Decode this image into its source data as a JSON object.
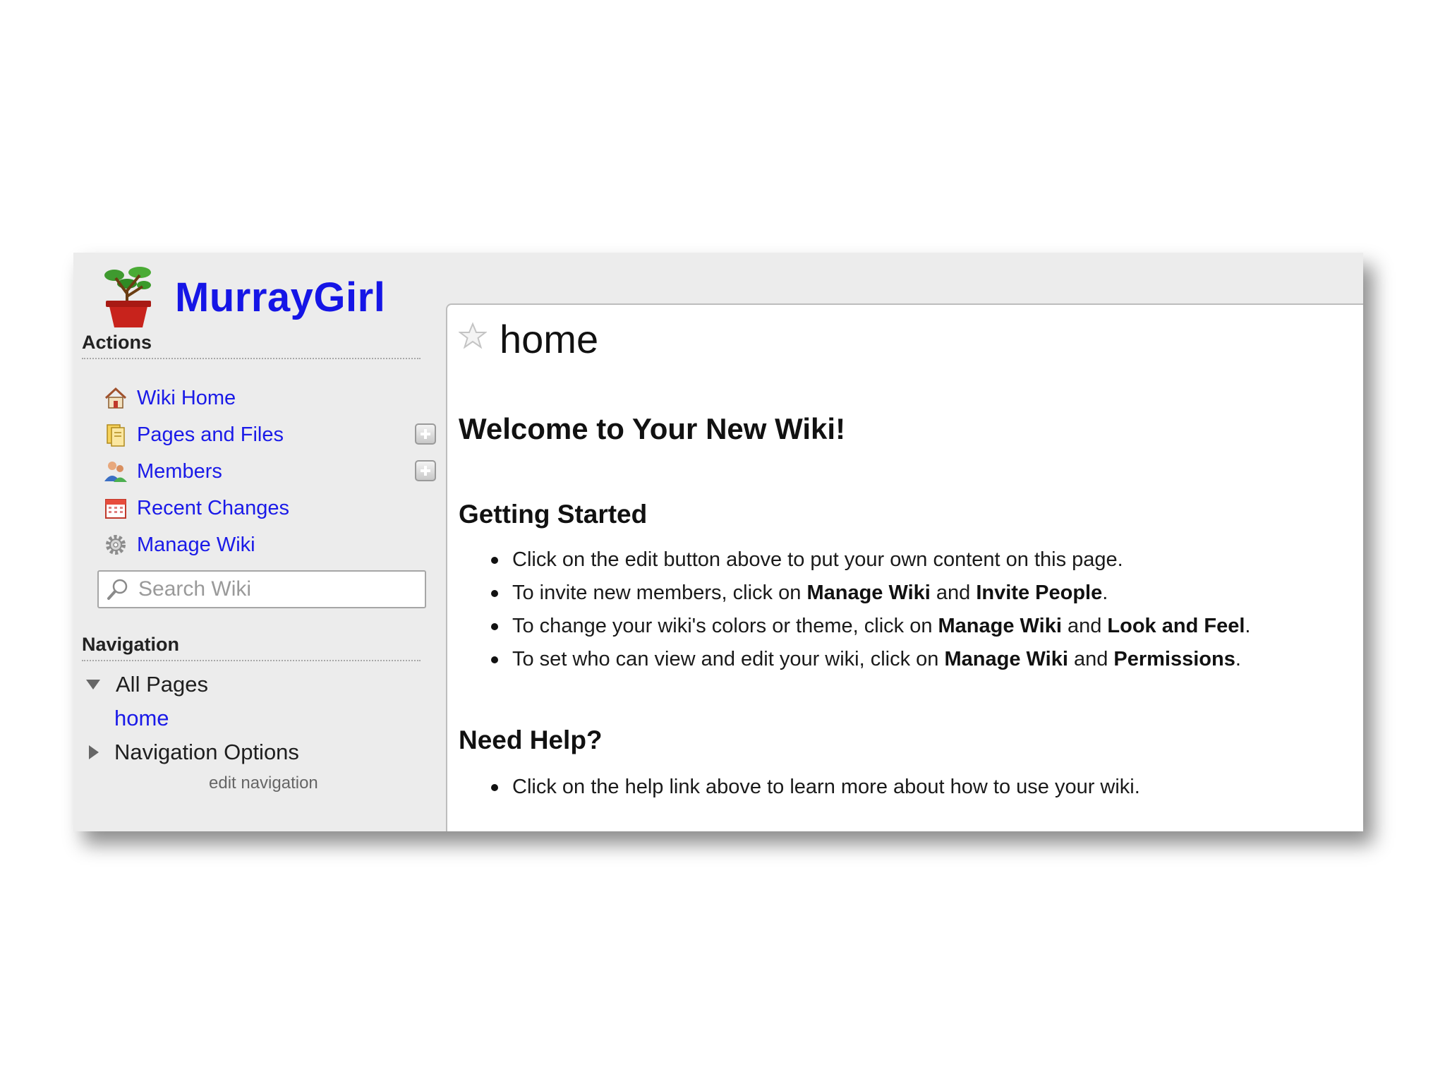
{
  "site": {
    "title": "MurrayGirl"
  },
  "actions": {
    "heading": "Actions",
    "items": [
      {
        "label": "Wiki Home",
        "icon": "house-icon"
      },
      {
        "label": "Pages and Files",
        "icon": "pages-folder-icon"
      },
      {
        "label": "Members",
        "icon": "members-icon"
      },
      {
        "label": "Recent Changes",
        "icon": "calendar-icon"
      },
      {
        "label": "Manage Wiki",
        "icon": "gear-icon"
      }
    ],
    "search_placeholder": "Search Wiki"
  },
  "navigation": {
    "heading": "Navigation",
    "all_pages": "All Pages",
    "home_link": "home",
    "options": "Navigation Options",
    "edit": "edit navigation"
  },
  "page": {
    "title": "home",
    "welcome": "Welcome to Your New Wiki!",
    "getting_started": {
      "heading": "Getting Started",
      "items": [
        {
          "pre": "Click on the edit button above to put your own content on this page.",
          "b1": "",
          "mid": "",
          "b2": "",
          "post": ""
        },
        {
          "pre": "To invite new members, click on ",
          "b1": "Manage Wiki",
          "mid": " and ",
          "b2": "Invite People",
          "post": "."
        },
        {
          "pre": "To change your wiki's colors or theme, click on ",
          "b1": "Manage Wiki",
          "mid": " and ",
          "b2": "Look and Feel",
          "post": "."
        },
        {
          "pre": "To set who can view and edit your wiki, click on ",
          "b1": "Manage Wiki",
          "mid": " and ",
          "b2": "Permissions",
          "post": "."
        }
      ]
    },
    "need_help": {
      "heading": "Need Help?",
      "items": [
        "Click on the help link above to learn more about how to use your wiki."
      ]
    }
  },
  "colors": {
    "title_blue": "#1515e6",
    "link_blue": "#1a1ae8",
    "sidebar_bg": "#ececec"
  }
}
